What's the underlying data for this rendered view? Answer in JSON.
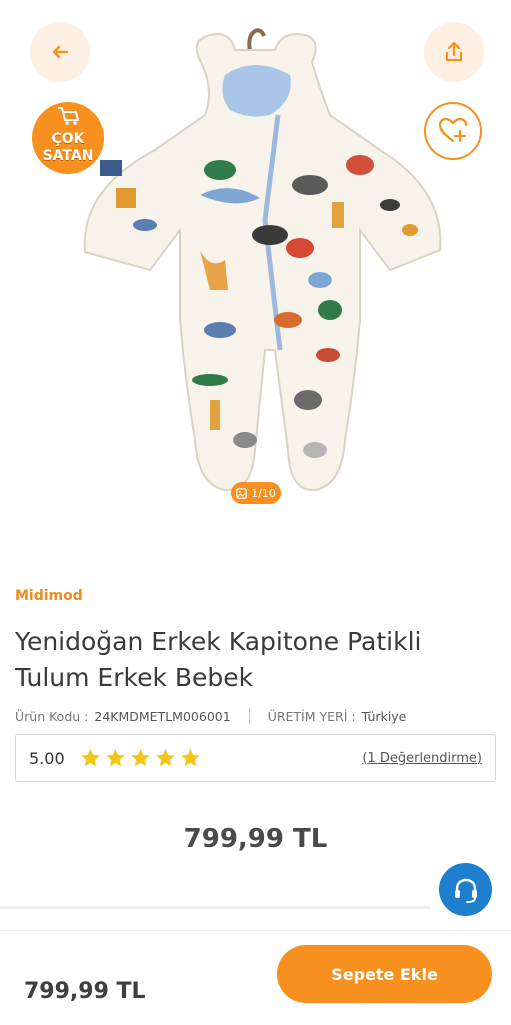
{
  "gallery": {
    "badge_line1": "ÇOK",
    "badge_line2": "SATAN",
    "image_counter": "1/10",
    "icons": [
      "arrow-left-icon",
      "share-icon",
      "heart-plus-icon",
      "shopping-cart-icon",
      "image-icon"
    ]
  },
  "product": {
    "brand": "Midimod",
    "title": "Yenidoğan Erkek Kapitone Patikli Tulum Erkek Bebek",
    "code_label": "Ürün Kodu :",
    "code_value": "24KMDMETLM006001",
    "origin_label": "ÜRETİM YERİ :",
    "origin_value": "Türkiye",
    "rating_score": "5.00",
    "rating_stars": 5,
    "reviews_link": "(1 Değerlendirme)",
    "price": "799,99 TL"
  },
  "bottom_bar": {
    "price": "799,99 TL",
    "add_to_cart": "Sepete Ekle"
  },
  "colors": {
    "accent": "#f7901e",
    "brand": "#f08a1c",
    "help_button": "#1e7fce",
    "star": "#f5c518"
  }
}
